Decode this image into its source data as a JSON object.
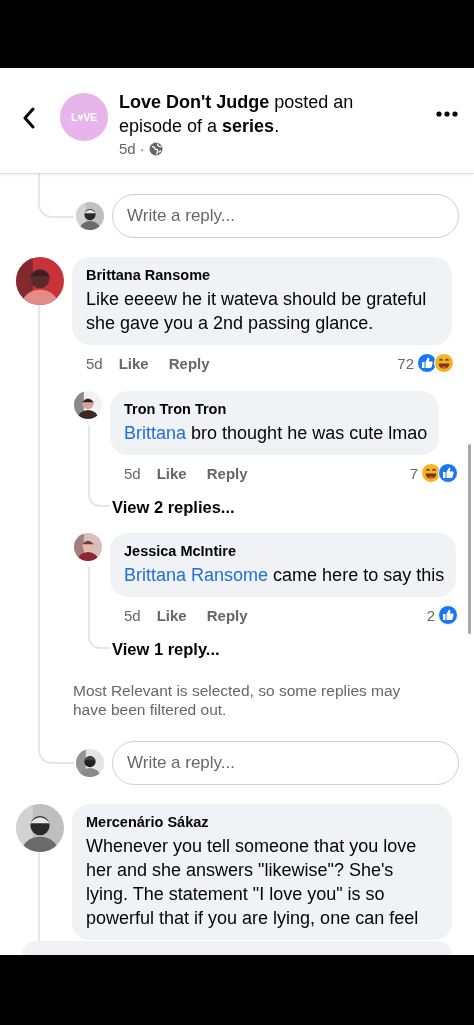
{
  "header": {
    "logo_text": "L♥VE",
    "title": "**Love Don't Judge** posted an episode of a **series**.",
    "time": "5d",
    "separator": "·"
  },
  "thread": [
    {
      "kind": "composer",
      "placeholder": "Write a reply..."
    },
    {
      "kind": "comment",
      "author": "Brittana Ransome",
      "text": "Like eeeew he it wateva should be grateful she gave you a 2nd passing glance.",
      "time": "5d",
      "like": "Like",
      "reply": "Reply",
      "count": "72",
      "reactions": [
        {
          "kind": "like"
        },
        {
          "kind": "haha"
        }
      ],
      "replies": [
        {
          "author": "Tron Tron Tron",
          "mention": "Brittana",
          "text": "bro thought he was cute lmao",
          "time": "5d",
          "like": "Like",
          "reply": "Reply",
          "count": "7",
          "reactions": [
            {
              "kind": "haha"
            },
            {
              "kind": "like"
            }
          ],
          "view_replies": "View 2 replies..."
        },
        {
          "author": "Jessica McIntire",
          "mention": "Brittana Ransome",
          "text": "came here to say this",
          "time": "5d",
          "like": "Like",
          "reply": "Reply",
          "count": "2",
          "reactions": [
            {
              "kind": "like"
            }
          ],
          "view_replies": "View 1 reply..."
        }
      ],
      "note": "Most Relevant is selected, so some replies may have been filtered out.",
      "composer": {
        "placeholder": "Write a reply..."
      }
    },
    {
      "kind": "comment",
      "author": "Mercenário Sákaz",
      "text": "Whenever you tell someone that you love her and she answers \"likewise\"? She's lying. The statement \"I love you\" is so powerful that if you are lying, one can feel"
    }
  ]
}
